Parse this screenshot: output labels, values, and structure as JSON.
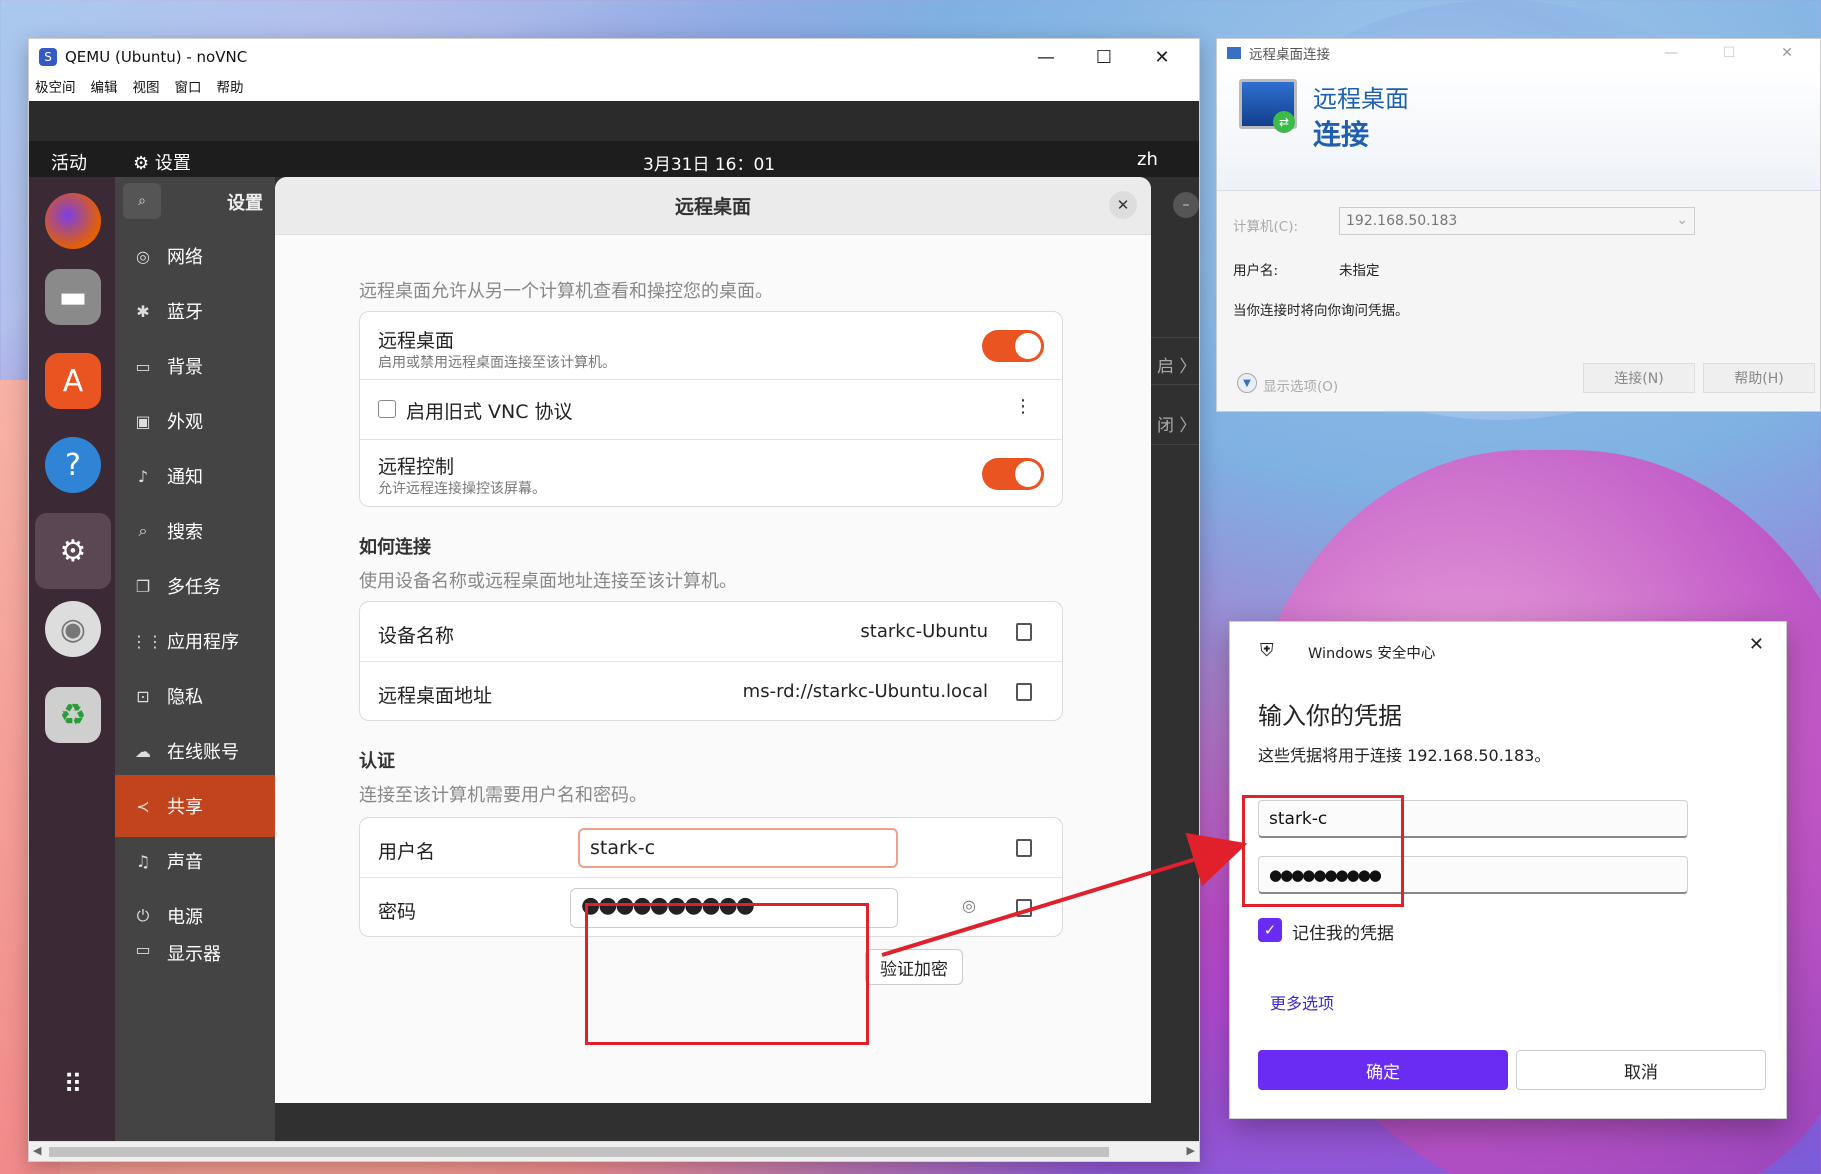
{
  "qemu": {
    "title": "QEMU (Ubuntu) - noVNC",
    "controls": [
      "—",
      "☐",
      "✕"
    ],
    "menu": [
      "极空间",
      "编辑",
      "视图",
      "窗口",
      "帮助"
    ]
  },
  "ubuntu": {
    "topbar": {
      "activities": "活动",
      "app": "⚙ 设置",
      "clock": "3月31日  16：01",
      "lang": "zh"
    },
    "dock": [
      "firefox-icon",
      "files-icon",
      "software-icon",
      "help-icon",
      "settings-icon",
      "disc-icon",
      "trash-icon",
      "apps-grid-icon"
    ],
    "sidebar_title": "设置",
    "sidebar": [
      {
        "icon": "◎",
        "label": "网络"
      },
      {
        "icon": "✱",
        "label": "蓝牙"
      },
      {
        "icon": "▭",
        "label": "背景"
      },
      {
        "icon": "▣",
        "label": "外观"
      },
      {
        "icon": "♪",
        "label": "通知"
      },
      {
        "icon": "⌕",
        "label": "搜索"
      },
      {
        "icon": "❐",
        "label": "多任务"
      },
      {
        "icon": "⋮⋮",
        "label": "应用程序"
      },
      {
        "icon": "⊡",
        "label": "隐私"
      },
      {
        "icon": "☁",
        "label": "在线账号"
      },
      {
        "icon": "≺",
        "label": "共享"
      },
      {
        "icon": "♫",
        "label": "声音"
      },
      {
        "icon": "⏻",
        "label": "电源"
      },
      {
        "icon": "▭",
        "label": "显示器"
      }
    ],
    "behind": {
      "r1": "启",
      "r2": "闭"
    }
  },
  "remote_desktop": {
    "title": "远程桌面",
    "intro": "远程桌面允许从另一个计算机查看和操控您的桌面。",
    "rd_toggle": {
      "label": "远程桌面",
      "sub": "启用或禁用远程桌面连接至该计算机。"
    },
    "vnc": {
      "label": "启用旧式 VNC 协议",
      "menu": "⋮"
    },
    "control": {
      "label": "远程控制",
      "sub": "允许远程连接操控该屏幕。"
    },
    "how_title": "如何连接",
    "how_sub": "使用设备名称或远程桌面地址连接至该计算机。",
    "device_name": {
      "label": "设备名称",
      "value": "starkc-Ubuntu"
    },
    "rd_address": {
      "label": "远程桌面地址",
      "value": "ms-rd://starkc-Ubuntu.local"
    },
    "auth_title": "认证",
    "auth_sub": "连接至该计算机需要用户名和密码。",
    "username": {
      "label": "用户名",
      "value": "stark-c"
    },
    "password": {
      "label": "密码",
      "value": "●●●●●●●●●●"
    },
    "verify_button": "验证加密"
  },
  "rdp": {
    "title": "远程桌面连接",
    "banner_line1": "远程桌面",
    "banner_line2": "连接",
    "computer_label": "计算机(C):",
    "computer_value": "192.168.50.183",
    "user_label": "用户名:",
    "user_value": "未指定",
    "note": "当你连接时将向你询问凭据。",
    "options": "显示选项(O)",
    "connect": "连接(N)",
    "help": "帮助(H)"
  },
  "security": {
    "app": "Windows 安全中心",
    "heading": "输入你的凭据",
    "desc": "这些凭据将用于连接 192.168.50.183。",
    "username": "stark-c",
    "password": "●●●●●●●●●●",
    "remember": "记住我的凭据",
    "more": "更多选项",
    "ok": "确定",
    "cancel": "取消"
  },
  "colors": {
    "ubuntu_orange": "#e95420",
    "annotation_red": "#e0202a",
    "win_accent": "#6a2cf2"
  }
}
